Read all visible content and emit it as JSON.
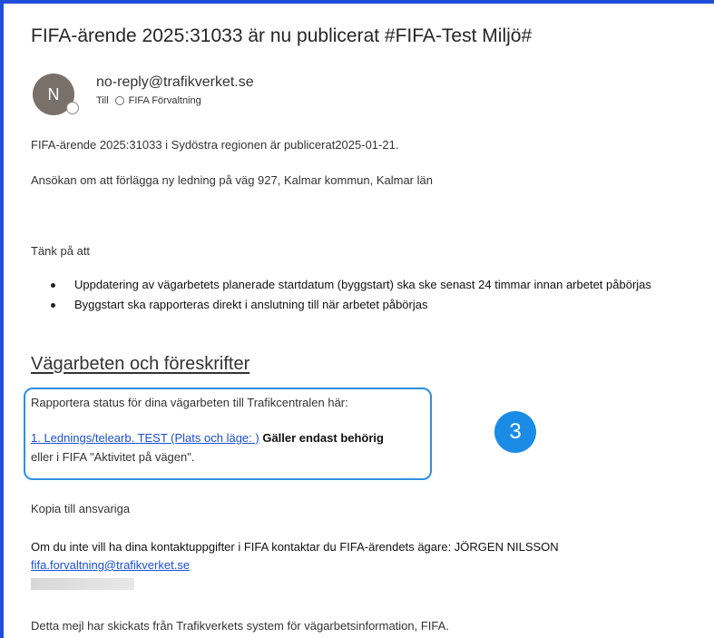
{
  "email": {
    "subject": "FIFA-ärende 2025:31033 är nu publicerat #FIFA-Test Miljö#",
    "sender_initial": "N",
    "sender": "no-reply@trafikverket.se",
    "to_label": "Till",
    "recipient": "FIFA Förvaltning"
  },
  "body": {
    "line1": "FIFA-ärende 2025:31033 i Sydöstra regionen är publicerat2025-01-21.",
    "line2": "Ansökan om att förlägga ny ledning på väg 927, Kalmar kommun, Kalmar län",
    "think_label": "Tänk på att",
    "bullets": [
      "Uppdatering av vägarbetets planerade startdatum (byggstart) ska ske senast 24 timmar innan arbetet påbörjas",
      "Byggstart ska rapporteras direkt i anslutning till när arbetet påbörjas"
    ],
    "section_heading": "Vägarbeten och föreskrifter",
    "report_text": "Rapportera status för dina vägarbeten till Trafikcentralen här:",
    "report_link": "1. Lednings/telearb. TEST (Plats och läge: )",
    "report_bold": "Gäller endast behörig",
    "report_tail": "eller i FIFA \"Aktivitet på vägen\".",
    "copy_label": "Kopia till ansvariga",
    "contact_text": "Om du inte vill ha dina kontaktuppgifter i FIFA kontaktar du FIFA-ärendets ägare: JÖRGEN NILSSON",
    "contact_email": "fifa.forvaltning@trafikverket.se",
    "footer": "Detta mejl har skickats från Trafikverkets system för vägarbetsinformation, FIFA."
  },
  "annotation": {
    "step_number": "3",
    "box_color": "#2f8fe0",
    "badge_color": "#1a8ce6"
  },
  "colors": {
    "accent_border": "#1f4fd8",
    "link": "#1a4fd6",
    "avatar": "#7a706a"
  }
}
